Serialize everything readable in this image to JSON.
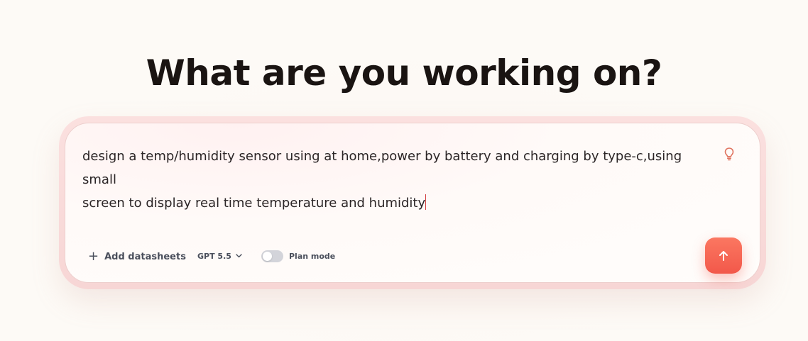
{
  "headline": "What are you working on?",
  "composer": {
    "text_line1": "design a temp/humidity sensor using at home,power by battery and charging by type-c,using small",
    "text_line2": "screen to display real time temperature and humidity",
    "idea_icon": "lightbulb-icon"
  },
  "toolbar": {
    "add_datasheets_label": "Add datasheets",
    "add_icon": "plus-icon",
    "model_label": "GPT 5.5",
    "model_icon": "chevron-down-icon",
    "plan_mode_label": "Plan mode",
    "plan_mode_enabled": false,
    "send_icon": "arrow-up-icon"
  },
  "colors": {
    "accent": "#f2584a",
    "headline": "#1a1412",
    "text": "#2b2526",
    "muted": "#4a4f5c"
  }
}
